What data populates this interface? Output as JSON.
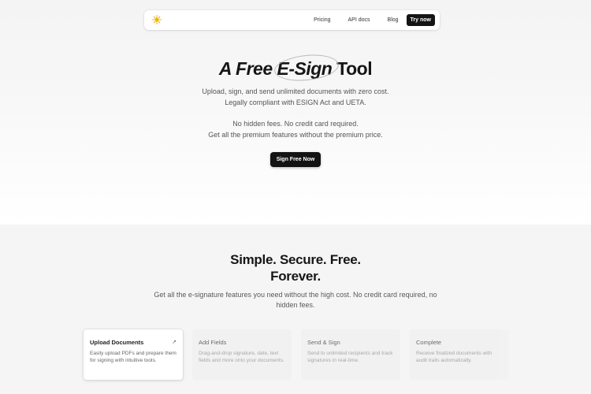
{
  "nav": {
    "logo_icon": "sun-icon",
    "links": [
      "Pricing",
      "API docs",
      "Blog"
    ],
    "cta": "Try now"
  },
  "hero": {
    "title_part1": "A Free",
    "title_part2": "E-Sign",
    "title_part3": "Tool",
    "line1": "Upload, sign, and send unlimited documents with zero cost.",
    "line2": "Legally compliant with ESIGN Act and UETA.",
    "line3": "No hidden fees. No credit card required.",
    "line4": "Get all the premium features without the premium price.",
    "cta": "Sign Free Now"
  },
  "features": {
    "title_line1": "Simple. Secure. Free.",
    "title_line2": "Forever.",
    "desc_line1": "Get all the e-signature features you need without the high cost. No credit card required, no",
    "desc_line2": "hidden fees.",
    "cards": [
      {
        "title": "Upload Documents",
        "desc": "Easily upload PDFs and prepare them for signing with intuitive tools.",
        "icon": "arrow-up-right-icon"
      },
      {
        "title": "Add Fields",
        "desc": "Drag-and-drop signature, date, text fields and more onto your documents."
      },
      {
        "title": "Send & Sign",
        "desc": "Send to unlimited recipients and track signatures in real-time."
      },
      {
        "title": "Complete",
        "desc": "Receive finalized documents with audit trails automatically."
      }
    ]
  },
  "colors": {
    "primary": "#141414",
    "background": "#f5f5f5",
    "logo": "#f2b705"
  }
}
